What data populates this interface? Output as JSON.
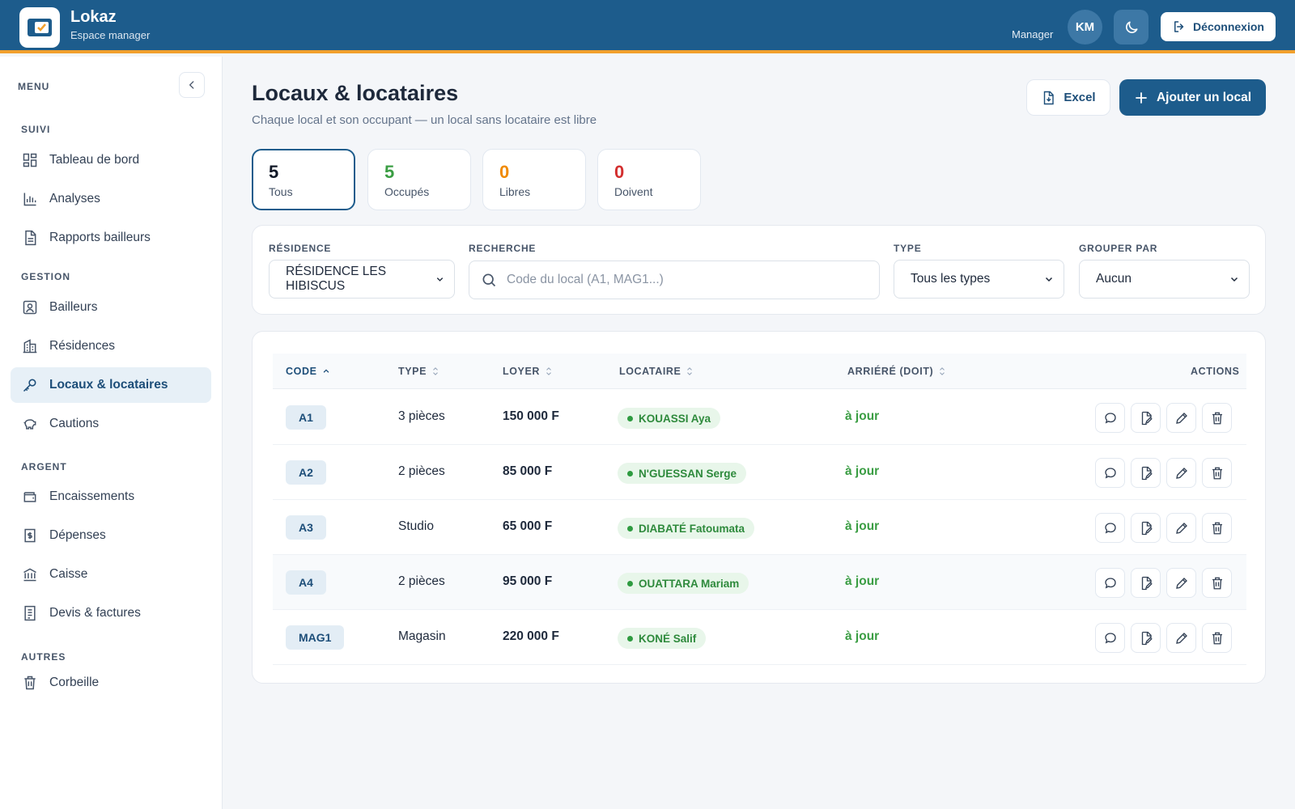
{
  "app": {
    "name": "Lokaz",
    "subtitle": "Espace manager"
  },
  "header": {
    "role": "Manager",
    "avatar_initials": "KM",
    "logout_label": "Déconnexion"
  },
  "sidebar": {
    "menu_title": "MENU",
    "sections": [
      {
        "label": "SUIVI",
        "items": [
          {
            "label": "Tableau de bord",
            "icon": "dashboard-icon"
          },
          {
            "label": "Analyses",
            "icon": "chart-icon"
          },
          {
            "label": "Rapports bailleurs",
            "icon": "report-icon"
          }
        ]
      },
      {
        "label": "GESTION",
        "items": [
          {
            "label": "Bailleurs",
            "icon": "person-icon"
          },
          {
            "label": "Résidences",
            "icon": "building-icon"
          },
          {
            "label": "Locaux & locataires",
            "icon": "key-icon",
            "active": true
          },
          {
            "label": "Cautions",
            "icon": "piggy-bank-icon"
          }
        ]
      },
      {
        "label": "ARGENT",
        "items": [
          {
            "label": "Encaissements",
            "icon": "wallet-icon"
          },
          {
            "label": "Dépenses",
            "icon": "receipt-icon"
          },
          {
            "label": "Caisse",
            "icon": "bank-icon"
          },
          {
            "label": "Devis & factures",
            "icon": "invoice-icon"
          }
        ]
      },
      {
        "label": "AUTRES",
        "items": [
          {
            "label": "Corbeille",
            "icon": "trash-icon"
          }
        ]
      }
    ]
  },
  "page": {
    "title": "Locaux & locataires",
    "subtitle": "Chaque local et son occupant — un local sans locataire est libre",
    "excel_label": "Excel",
    "add_label": "Ajouter un local"
  },
  "stats": [
    {
      "value": "5",
      "label": "Tous",
      "color": "#111827",
      "selected": true
    },
    {
      "value": "5",
      "label": "Occupés",
      "color": "#3a9d43"
    },
    {
      "value": "0",
      "label": "Libres",
      "color": "#f08a00"
    },
    {
      "value": "0",
      "label": "Doivent",
      "color": "#d32f2f"
    }
  ],
  "filters": {
    "residence_label": "RÉSIDENCE",
    "residence_value": "RÉSIDENCE LES HIBISCUS",
    "search_label": "RECHERCHE",
    "search_placeholder": "Code du local (A1, MAG1...)",
    "type_label": "TYPE",
    "type_value": "Tous les types",
    "group_label": "GROUPER PAR",
    "group_value": "Aucun"
  },
  "table": {
    "columns": [
      "CODE",
      "TYPE",
      "LOYER",
      "LOCATAIRE",
      "ARRIÉRÉ (DOIT)",
      "ACTIONS"
    ],
    "rows": [
      {
        "code": "A1",
        "type": "3 pièces",
        "rent": "150 000 F",
        "tenant": "KOUASSI Aya",
        "status": "à jour"
      },
      {
        "code": "A2",
        "type": "2 pièces",
        "rent": "85 000 F",
        "tenant": "N'GUESSAN Serge",
        "status": "à jour"
      },
      {
        "code": "A3",
        "type": "Studio",
        "rent": "65 000 F",
        "tenant": "DIABATÉ Fatoumata",
        "status": "à jour"
      },
      {
        "code": "A4",
        "type": "2 pièces",
        "rent": "95 000 F",
        "tenant": "OUATTARA Mariam",
        "status": "à jour"
      },
      {
        "code": "MAG1",
        "type": "Magasin",
        "rent": "220 000 F",
        "tenant": "KONÉ Salif",
        "status": "à jour"
      }
    ]
  },
  "colors": {
    "primary": "#1d5c8c",
    "accent": "#f2a02d",
    "success": "#3a9d43"
  }
}
